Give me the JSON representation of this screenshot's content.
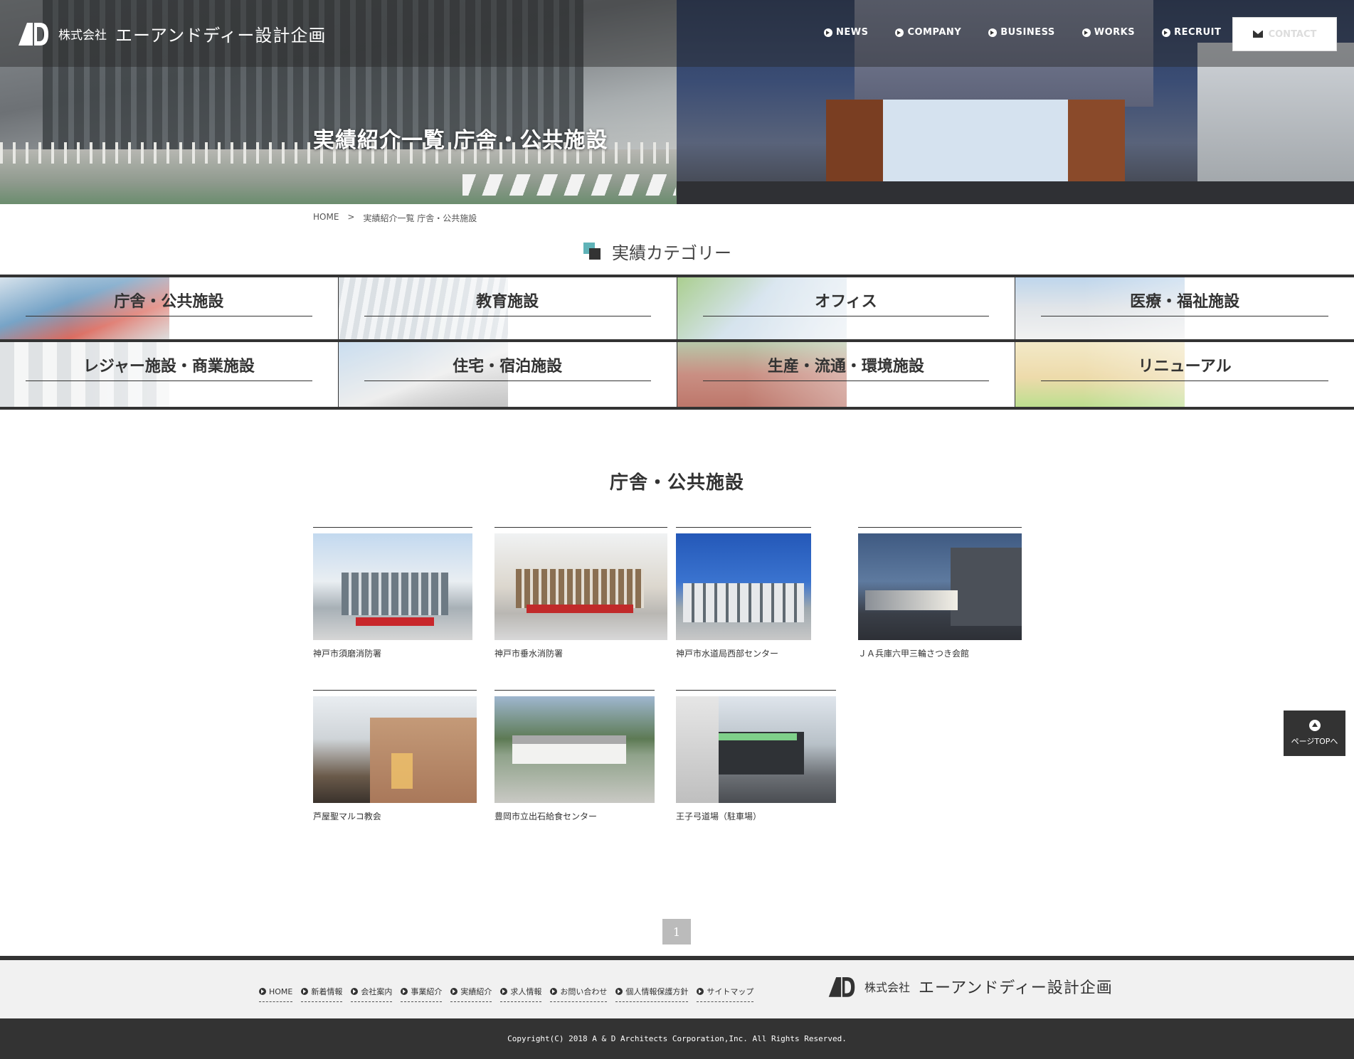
{
  "header": {
    "logo_small": "株式会社",
    "logo_big": "エーアンドディー設計企画",
    "nav": [
      {
        "label": "NEWS"
      },
      {
        "label": "COMPANY"
      },
      {
        "label": "BUSINESS"
      },
      {
        "label": "WORKS"
      },
      {
        "label": "RECRUIT"
      }
    ],
    "contact_label": "CONTACT"
  },
  "hero": {
    "title": "実績紹介一覧 庁舎・公共施設"
  },
  "breadcrumb": {
    "home": "HOME",
    "sep": ">",
    "current": "実績紹介一覧 庁舎・公共施設"
  },
  "categories": {
    "heading": "実績カテゴリー",
    "items": [
      {
        "label": "庁舎・公共施設"
      },
      {
        "label": "教育施設"
      },
      {
        "label": "オフィス"
      },
      {
        "label": "医療・福祉施設"
      },
      {
        "label": "レジャー施設・商業施設"
      },
      {
        "label": "住宅・宿泊施設"
      },
      {
        "label": "生産・流通・環境施設"
      },
      {
        "label": "リニューアル"
      }
    ]
  },
  "section": {
    "title": "庁舎・公共施設"
  },
  "works": [
    {
      "caption": "神戸市須磨消防署"
    },
    {
      "caption": "神戸市垂水消防署"
    },
    {
      "caption": "神戸市水道局西部センター"
    },
    {
      "caption": "ＪＡ兵庫六甲三輪さつき会館"
    },
    {
      "caption": "芦屋聖マルコ教会"
    },
    {
      "caption": "豊岡市立出石給食センター"
    },
    {
      "caption": "王子弓道場（駐車場）"
    }
  ],
  "pagination": {
    "current": "1"
  },
  "pagetop": {
    "label": "ページTOPへ"
  },
  "footer": {
    "nav": [
      {
        "label": "HOME"
      },
      {
        "label": "新着情報"
      },
      {
        "label": "会社案内"
      },
      {
        "label": "事業紹介"
      },
      {
        "label": "実績紹介"
      },
      {
        "label": "求人情報"
      },
      {
        "label": "お問い合わせ"
      },
      {
        "label": "個人情報保護方針"
      },
      {
        "label": "サイトマップ"
      }
    ],
    "logo_small": "株式会社",
    "logo_big": "エーアンドディー設計企画",
    "copyright": "Copyright(C) 2018 A & D Architects Corporation,Inc. All Rights Reserved."
  }
}
